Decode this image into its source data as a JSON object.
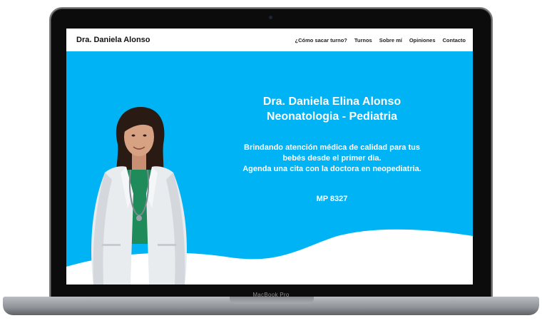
{
  "device": {
    "model_label": "MacBook Pro"
  },
  "header": {
    "brand": "Dra. Daniela Alonso",
    "nav": [
      {
        "label": "¿Cómo sacar turno?"
      },
      {
        "label": "Turnos"
      },
      {
        "label": "Sobre mí"
      },
      {
        "label": "Opiniones"
      },
      {
        "label": "Contacto"
      }
    ]
  },
  "hero": {
    "title_line1": "Dra. Daniela Elina Alonso",
    "title_line2": "Neonatologia - Pediatria",
    "desc_line1": "Brindando atención médica de calidad para tus",
    "desc_line2": "bebés desde el primer dia.",
    "desc_line3": "Agenda una cita con la doctora en neopediatria.",
    "license": "MP 8327"
  },
  "colors": {
    "hero_bg": "#00b3f5",
    "wave": "#ffffff",
    "text": "#ffffff"
  }
}
